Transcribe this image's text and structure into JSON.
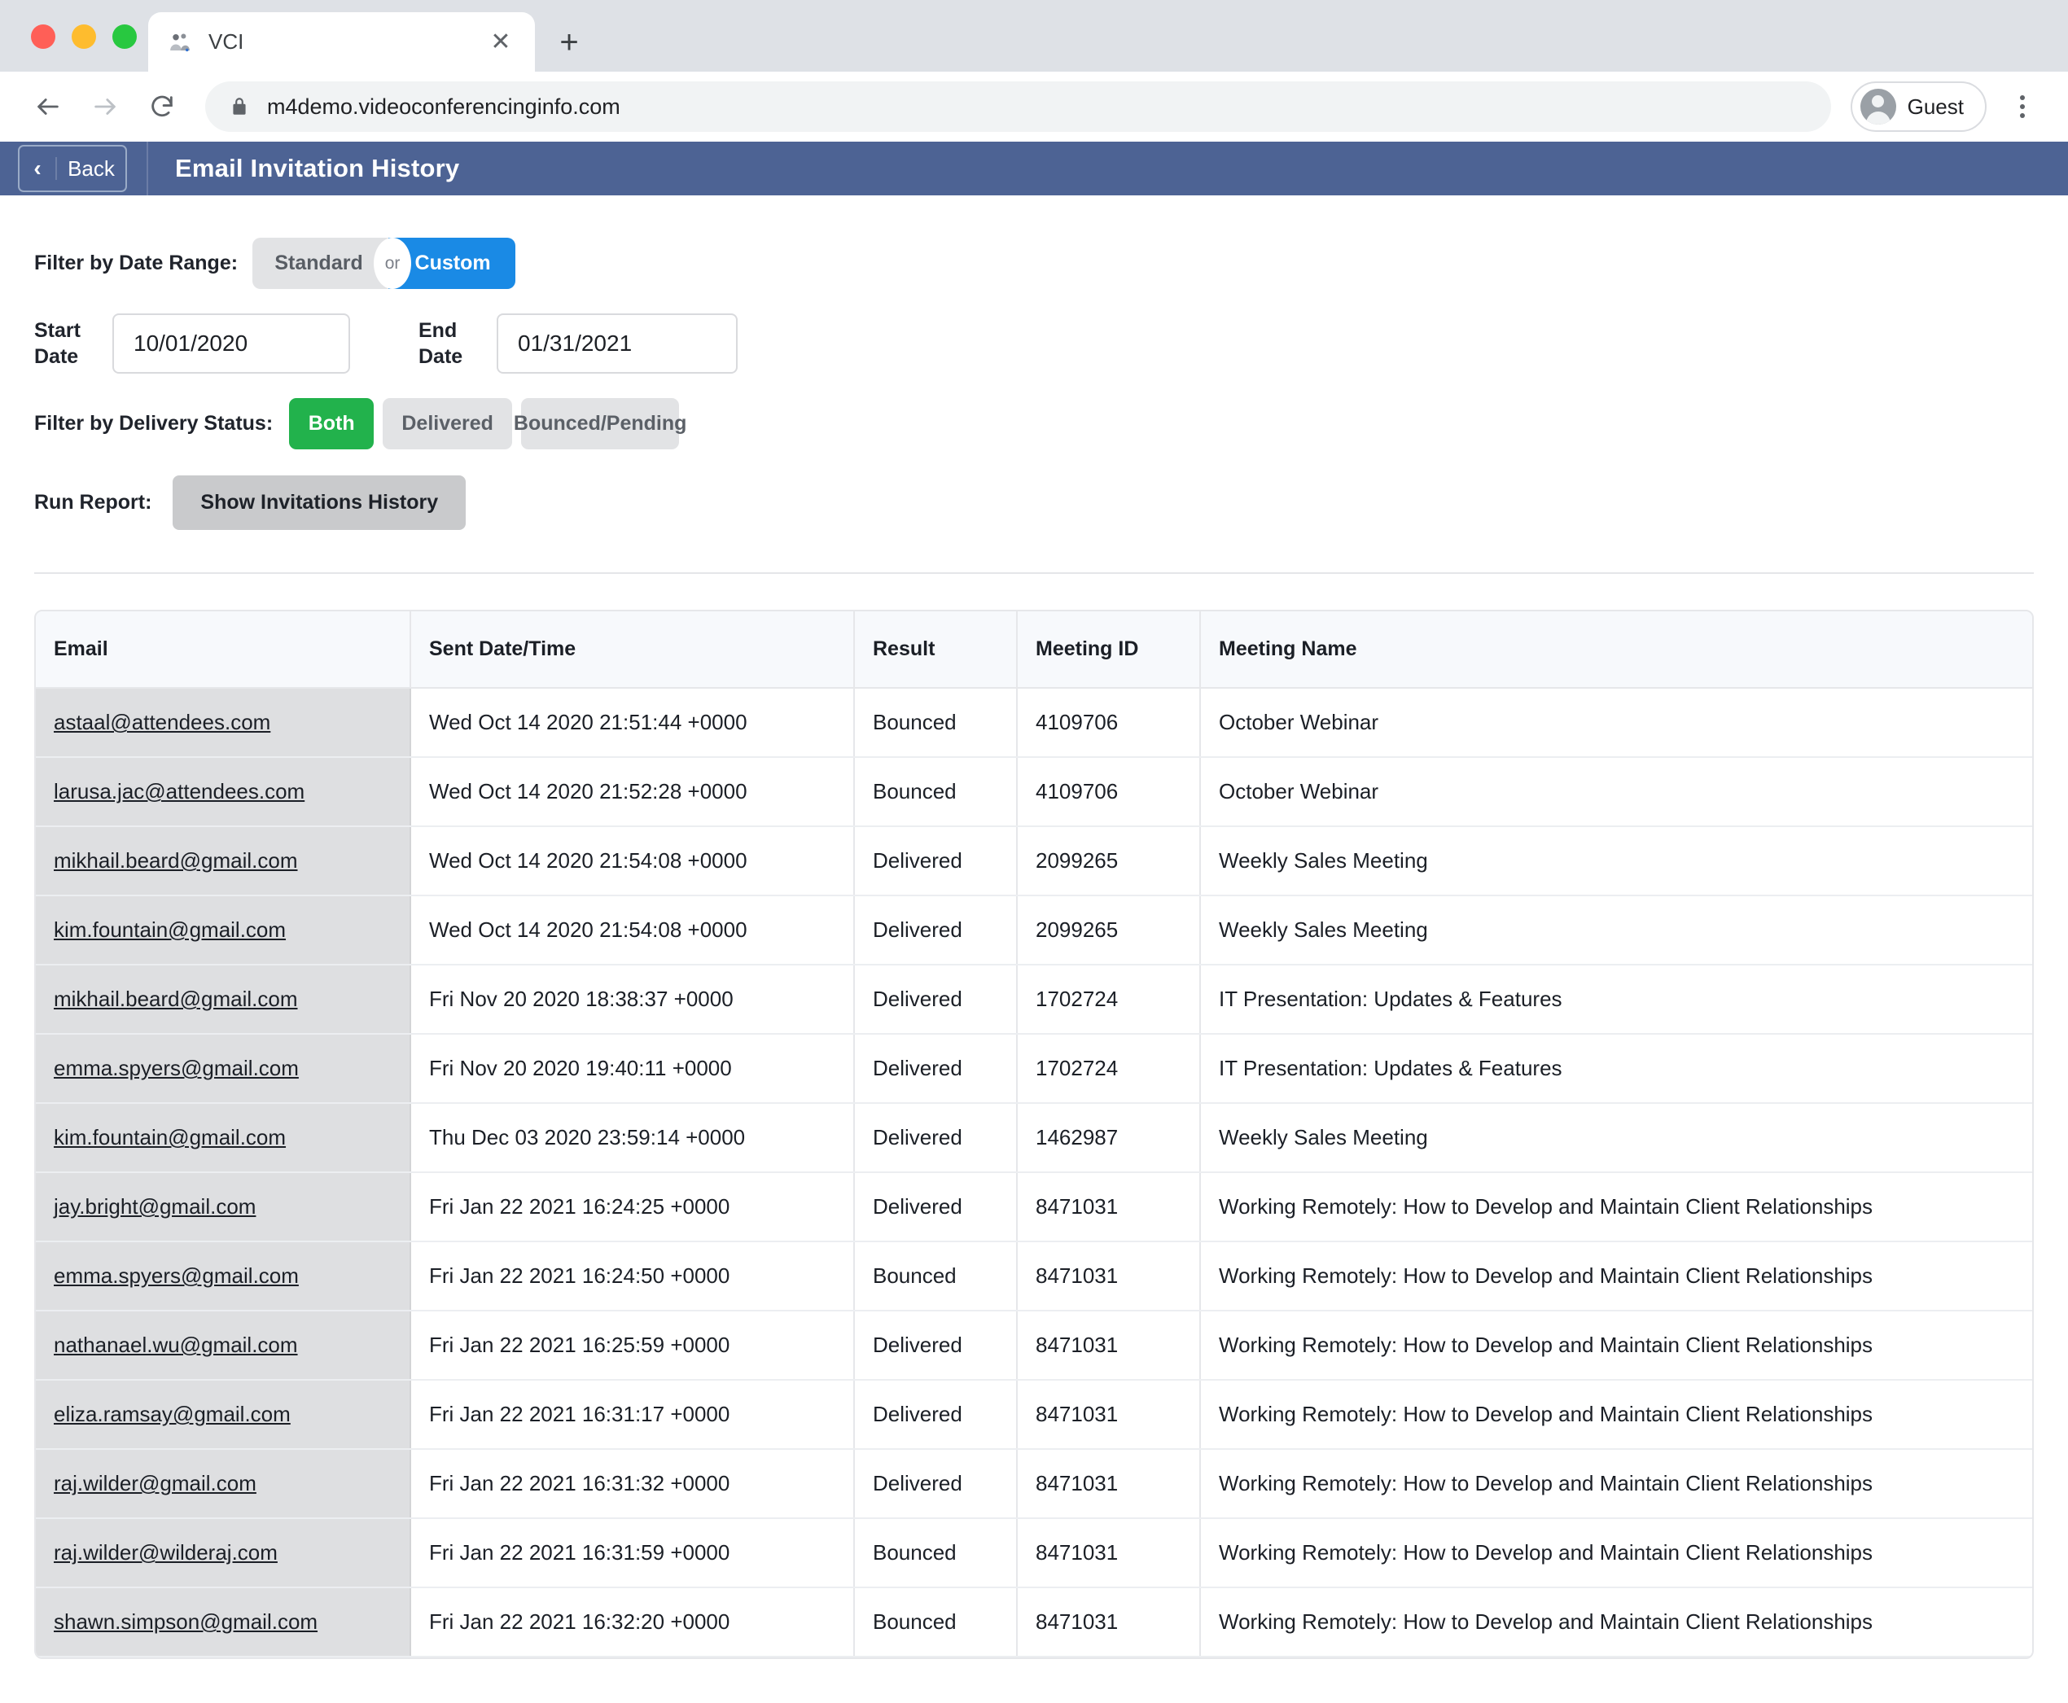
{
  "browser": {
    "tab": {
      "title": "VCI",
      "favicon_icon": "people-group-icon",
      "close_icon": "close-icon"
    },
    "new_tab_icon": "plus-icon",
    "nav": {
      "back_icon": "arrow-left-icon",
      "forward_icon": "arrow-right-icon",
      "reload_icon": "reload-icon"
    },
    "omnibox": {
      "lock_icon": "lock-icon",
      "url": "m4demo.videoconferencinginfo.com"
    },
    "profile": {
      "avatar_icon": "account-circle-icon",
      "name": "Guest"
    },
    "menu_icon": "kebab-menu-icon"
  },
  "app_header": {
    "back_chevron_icon": "chevron-left-icon",
    "back_label": "Back",
    "title": "Email Invitation History",
    "bar_color": "#4d6394"
  },
  "filters": {
    "date_range_label": "Filter by Date Range:",
    "segment_standard": "Standard",
    "segment_or": "or",
    "segment_custom": "Custom",
    "segment_selected": "Custom",
    "custom_color": "#1a8ae5",
    "start_date_label": "Start Date",
    "start_date_value": "10/01/2020",
    "end_date_label": "End Date",
    "end_date_value": "01/31/2021",
    "delivery_status_label": "Filter by Delivery Status:",
    "status_both": "Both",
    "status_delivered": "Delivered",
    "status_bounced": "Bounced/Pending",
    "status_selected": "Both",
    "both_color": "#22b24c",
    "run_report_label": "Run Report:",
    "run_report_button": "Show Invitations History"
  },
  "table": {
    "columns": [
      "Email",
      "Sent Date/Time",
      "Result",
      "Meeting ID",
      "Meeting Name"
    ],
    "rows": [
      {
        "email": "astaal@attendees.com",
        "sent": "Wed Oct 14 2020 21:51:44 +0000",
        "result": "Bounced",
        "meeting_id": "4109706",
        "meeting_name": "October Webinar"
      },
      {
        "email": "larusa.jac@attendees.com",
        "sent": "Wed Oct 14 2020 21:52:28 +0000",
        "result": "Bounced",
        "meeting_id": "4109706",
        "meeting_name": "October Webinar"
      },
      {
        "email": "mikhail.beard@gmail.com",
        "sent": "Wed Oct 14 2020 21:54:08 +0000",
        "result": "Delivered",
        "meeting_id": "2099265",
        "meeting_name": "Weekly Sales Meeting"
      },
      {
        "email": "kim.fountain@gmail.com",
        "sent": "Wed Oct 14 2020 21:54:08 +0000",
        "result": "Delivered",
        "meeting_id": "2099265",
        "meeting_name": "Weekly Sales Meeting"
      },
      {
        "email": "mikhail.beard@gmail.com",
        "sent": "Fri Nov 20 2020 18:38:37 +0000",
        "result": "Delivered",
        "meeting_id": "1702724",
        "meeting_name": "IT Presentation: Updates & Features"
      },
      {
        "email": "emma.spyers@gmail.com",
        "sent": "Fri Nov 20 2020 19:40:11 +0000",
        "result": "Delivered",
        "meeting_id": "1702724",
        "meeting_name": "IT Presentation: Updates & Features"
      },
      {
        "email": "kim.fountain@gmail.com",
        "sent": "Thu Dec 03 2020 23:59:14 +0000",
        "result": "Delivered",
        "meeting_id": "1462987",
        "meeting_name": "Weekly Sales Meeting"
      },
      {
        "email": "jay.bright@gmail.com",
        "sent": "Fri Jan 22 2021 16:24:25 +0000",
        "result": "Delivered",
        "meeting_id": "8471031",
        "meeting_name": "Working Remotely: How to Develop and Maintain Client Relationships"
      },
      {
        "email": "emma.spyers@gmail.com",
        "sent": "Fri Jan 22 2021 16:24:50 +0000",
        "result": "Bounced",
        "meeting_id": "8471031",
        "meeting_name": "Working Remotely: How to Develop and Maintain Client Relationships"
      },
      {
        "email": "nathanael.wu@gmail.com",
        "sent": "Fri Jan 22 2021 16:25:59 +0000",
        "result": "Delivered",
        "meeting_id": "8471031",
        "meeting_name": "Working Remotely: How to Develop and Maintain Client Relationships"
      },
      {
        "email": "eliza.ramsay@gmail.com",
        "sent": "Fri Jan 22 2021 16:31:17 +0000",
        "result": "Delivered",
        "meeting_id": "8471031",
        "meeting_name": "Working Remotely: How to Develop and Maintain Client Relationships"
      },
      {
        "email": "raj.wilder@gmail.com",
        "sent": "Fri Jan 22 2021 16:31:32 +0000",
        "result": "Delivered",
        "meeting_id": "8471031",
        "meeting_name": "Working Remotely: How to Develop and Maintain Client Relationships"
      },
      {
        "email": "raj.wilder@wilderaj.com",
        "sent": "Fri Jan 22 2021 16:31:59 +0000",
        "result": "Bounced",
        "meeting_id": "8471031",
        "meeting_name": "Working Remotely: How to Develop and Maintain Client Relationships"
      },
      {
        "email": "shawn.simpson@gmail.com",
        "sent": "Fri Jan 22 2021 16:32:20 +0000",
        "result": "Bounced",
        "meeting_id": "8471031",
        "meeting_name": "Working Remotely: How to Develop and Maintain Client Relationships"
      }
    ]
  }
}
